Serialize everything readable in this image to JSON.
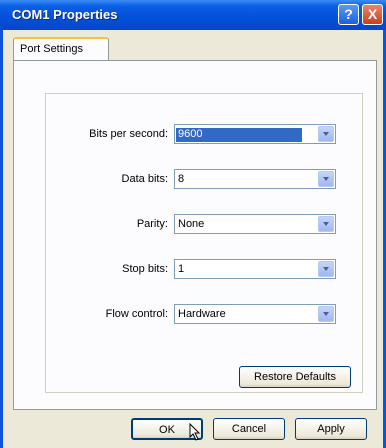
{
  "window": {
    "title": "COM1 Properties",
    "help_glyph": "?",
    "close_glyph": "X"
  },
  "tab": {
    "label": "Port Settings"
  },
  "fields": [
    {
      "label": "Bits per second:",
      "value": "9600"
    },
    {
      "label": "Data bits:",
      "value": "8"
    },
    {
      "label": "Parity:",
      "value": "None"
    },
    {
      "label": "Stop bits:",
      "value": "1"
    },
    {
      "label": "Flow control:",
      "value": "Hardware"
    }
  ],
  "buttons": {
    "restore": "Restore Defaults",
    "ok": "OK",
    "cancel": "Cancel",
    "apply": "Apply"
  }
}
